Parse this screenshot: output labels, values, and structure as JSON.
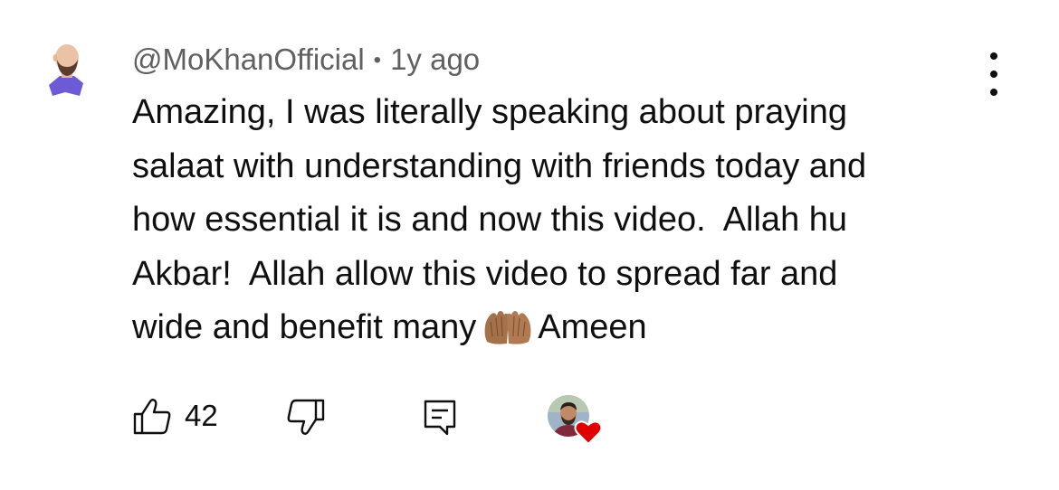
{
  "comment": {
    "author": "@MoKhanOfficial",
    "separator": "•",
    "timestamp": "1y ago",
    "text_lines": [
      "Amazing, I was literally speaking about praying",
      "salaat with understanding with friends today and",
      "how essential it is and now this video.  Allah hu",
      "Akbar!  Allah allow this video to spread far and"
    ],
    "last_line_before_emoji": "wide and benefit many",
    "emoji_name": "palms-up-together",
    "last_line_after_emoji": "Ameen",
    "like_count": "42",
    "hearted_by_creator": true
  },
  "colors": {
    "text": "#0f0f0f",
    "secondary_text": "#606060",
    "heart": "#e00000",
    "avatar_accent": "#6b5bd6"
  },
  "icons": {
    "more": "three-dots-vertical-icon",
    "like": "thumbs-up-icon",
    "dislike": "thumbs-down-icon",
    "reply": "comment-icon",
    "heart": "heart-icon"
  }
}
